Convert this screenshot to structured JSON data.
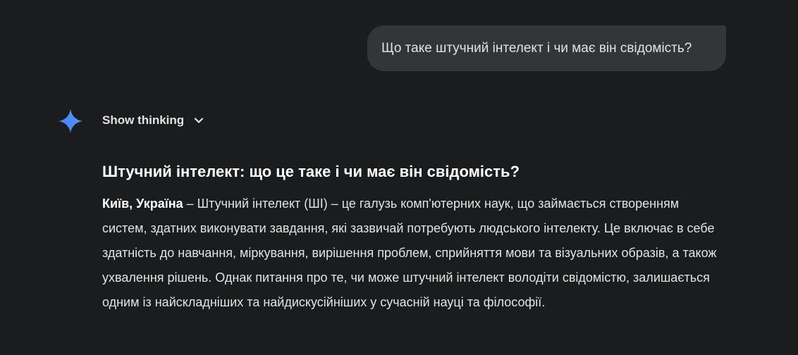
{
  "user_message": {
    "text": "Що таке штучний інтелект і чи має він свідомість?"
  },
  "assistant": {
    "icon": "sparkle-icon",
    "show_thinking_label": "Show thinking",
    "title": "Штучний інтелект: що це таке і чи має він свідомість?",
    "dateline": "Київ, Україна",
    "body": " – Штучний інтелект (ШІ) – це галузь комп'ютерних наук, що займається створенням систем, здатних виконувати завдання, які зазвичай потребують людського інтелекту. Це включає в себе здатність до навчання, міркування, вирішення проблем, сприйняття мови та візуальних образів, а також ухвалення рішень. Однак питання про те, чи може штучний інтелект володіти свідомістю, залишається одним із найскладніших та найдискусійніших у сучасній науці та філософії."
  },
  "colors": {
    "background": "#1b1c1d",
    "bubble": "#333537",
    "text": "#e3e3e3",
    "sparkle_gradient": [
      "#4f8df6",
      "#9b72cb",
      "#d96570"
    ]
  }
}
